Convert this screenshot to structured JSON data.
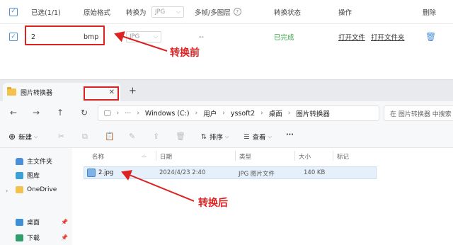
{
  "converter": {
    "header": {
      "selected": "已选(1/1)",
      "original_format": "原始格式",
      "convert_to": "转换为",
      "convert_select": "JPG",
      "multi_frame": "多帧/多图层",
      "help": "?",
      "status": "转换状态",
      "action": "操作",
      "delete": "删除"
    },
    "row": {
      "name": "2",
      "format": "bmp",
      "target": "JPG",
      "multi_frame": "--",
      "status": "已完成",
      "open_file": "打开文件",
      "open_folder": "打开文件夹"
    },
    "annotation_before": "转换前"
  },
  "explorer": {
    "tab_title": "图片转换器",
    "address": [
      "Windows (C:)",
      "用户",
      "yssoft2",
      "桌面",
      "图片转换器"
    ],
    "search_placeholder": "在 图片转换器 中搜索",
    "toolbar": {
      "new": "新建",
      "sort": "排序",
      "view": "查看",
      "more": "···"
    },
    "sidebar": [
      {
        "label": "主文件夹"
      },
      {
        "label": "图库"
      },
      {
        "label": "OneDrive"
      },
      {
        "label": "桌面"
      },
      {
        "label": "下载"
      }
    ],
    "columns": {
      "name": "名称",
      "date": "日期",
      "type": "类型",
      "size": "大小",
      "tag": "标记"
    },
    "file": {
      "name": "2.jpg",
      "date": "2024/4/23 2:40",
      "type": "JPG 图片文件",
      "size": "140 KB"
    },
    "annotation_after": "转换后"
  },
  "colors": {
    "accent": "#4a8fd8",
    "success": "#3aa648",
    "annotation": "#dd2222"
  }
}
